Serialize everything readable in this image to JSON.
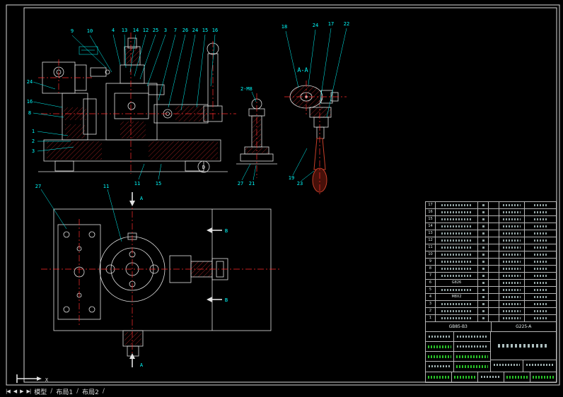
{
  "statusbar": {
    "nav_first": "|◀",
    "nav_prev": "◀",
    "nav_next": "▶",
    "nav_last": "▶|",
    "tabs": [
      {
        "label": "模型"
      },
      {
        "label": "布局1"
      },
      {
        "label": "布局2"
      }
    ],
    "separator": "/"
  },
  "ucs": {
    "x_label": "X"
  },
  "views": {
    "front": {
      "top_callouts": [
        "9",
        "10",
        "4",
        "13",
        "14",
        "12",
        "25",
        "3",
        "7",
        "26",
        "24",
        "15",
        "16"
      ],
      "left_callouts": [
        "24",
        "16",
        "8",
        "1",
        "2",
        "3"
      ],
      "bottom_callouts": [
        "11",
        "15"
      ],
      "detail_label": "D"
    },
    "middle": {
      "thread_note": "2-M8",
      "bottom_callouts": [
        "27",
        "21"
      ]
    },
    "section": {
      "label": "A-A",
      "top_callouts": [
        "18",
        "24",
        "17",
        "22"
      ],
      "bottom_callouts": [
        "19",
        "23"
      ]
    },
    "plan": {
      "section_a": "A",
      "section_b": "B",
      "callouts": [
        "27",
        "11"
      ]
    }
  },
  "bom": {
    "rows": [
      {
        "no": "17"
      },
      {
        "no": "16"
      },
      {
        "no": "15"
      },
      {
        "no": "14"
      },
      {
        "no": "13"
      },
      {
        "no": "12"
      },
      {
        "no": "11"
      },
      {
        "no": "10"
      },
      {
        "no": "9"
      },
      {
        "no": "8"
      },
      {
        "no": "7"
      },
      {
        "no": "6",
        "name": "G826"
      },
      {
        "no": "5"
      },
      {
        "no": "4",
        "name": "M8X2"
      },
      {
        "no": "3"
      },
      {
        "no": "2"
      },
      {
        "no": "1"
      }
    ],
    "code_band": {
      "left": "GB85-B3",
      "right": "G225-A"
    }
  }
}
